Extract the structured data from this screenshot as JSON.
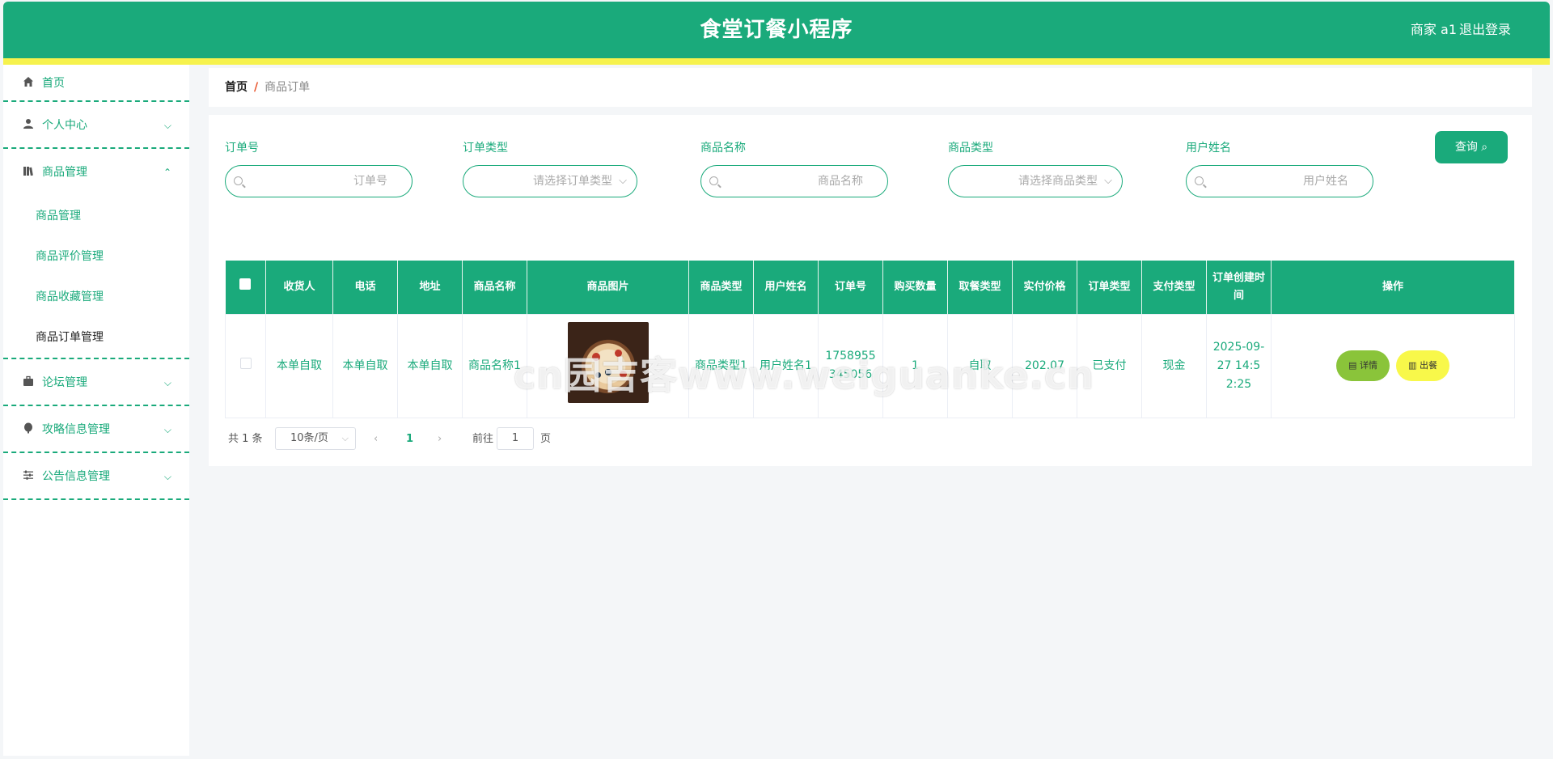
{
  "header": {
    "title": "食堂订餐小程序",
    "user": "商家 a1",
    "logout": "退出登录"
  },
  "sidebar": {
    "home": "首页",
    "personal": "个人中心",
    "goods": "商品管理",
    "goods_sub": [
      "商品管理",
      "商品评价管理",
      "商品收藏管理",
      "商品订单管理"
    ],
    "forum": "论坛管理",
    "guide": "攻略信息管理",
    "notice": "公告信息管理"
  },
  "breadcrumb": {
    "home": "首页",
    "sep": "/",
    "current": "商品订单"
  },
  "search": {
    "order_no_label": "订单号",
    "order_no_placeholder": "订单号",
    "order_type_label": "订单类型",
    "order_type_placeholder": "请选择订单类型",
    "goods_name_label": "商品名称",
    "goods_name_placeholder": "商品名称",
    "goods_type_label": "商品类型",
    "goods_type_placeholder": "请选择商品类型",
    "user_name_label": "用户姓名",
    "user_name_placeholder": "用户姓名",
    "query_button": "查询"
  },
  "table": {
    "headers": [
      "收货人",
      "电话",
      "地址",
      "商品名称",
      "商品图片",
      "商品类型",
      "用户姓名",
      "订单号",
      "购买数量",
      "取餐类型",
      "实付价格",
      "订单类型",
      "支付类型",
      "订单创建时间",
      "操作"
    ],
    "rows": [
      {
        "receiver": "本单自取",
        "phone": "本单自取",
        "address": "本单自取",
        "goods_name": "商品名称1",
        "goods_type": "商品类型1",
        "user_name": "用户姓名1",
        "order_no": "1758955345056",
        "quantity": "1",
        "pickup_type": "自取",
        "price": "202.07",
        "order_type": "已支付",
        "pay_type": "现金",
        "created": "2025-09-27 14:52:25",
        "detail_label": "详情",
        "serve_label": "出餐"
      }
    ]
  },
  "pagination": {
    "total": "共 1 条",
    "page_size": "10条/页",
    "current_page": "1",
    "goto_label": "前往",
    "goto_value": "1",
    "page_suffix": "页"
  },
  "watermark": "cn园吉客www.weiguanke.cn",
  "colors": {
    "primary": "#1aaa7b",
    "accent_line": "#f6f24d",
    "detail_button": "#8ac43a",
    "serve_button": "#f8f84a"
  }
}
